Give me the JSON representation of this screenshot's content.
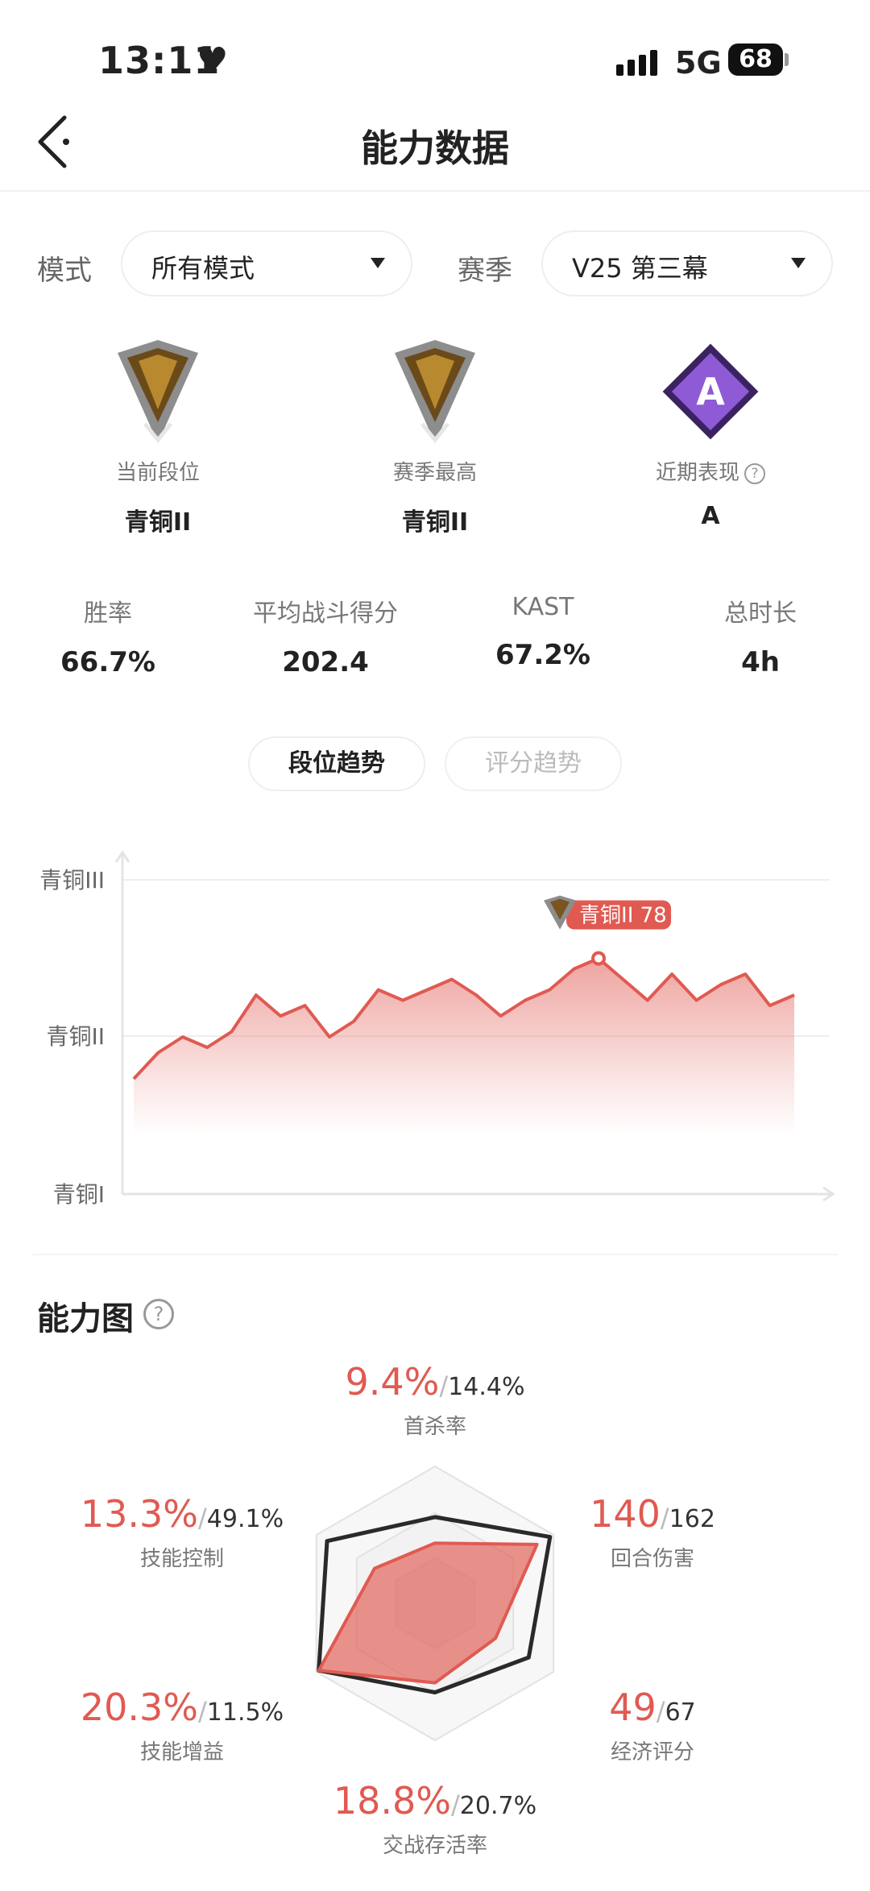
{
  "status_bar": {
    "time": "13:11",
    "network": "5G",
    "battery": "68"
  },
  "header": {
    "title": "能力数据"
  },
  "filters": {
    "mode_label": "模式",
    "mode_value": "所有模式",
    "season_label": "赛季",
    "season_value": "V25 第三幕"
  },
  "ranks": [
    {
      "label": "当前段位",
      "value": "青铜II"
    },
    {
      "label": "赛季最高",
      "value": "青铜II"
    },
    {
      "label": "近期表现",
      "value": "A",
      "badge_letter": "A"
    }
  ],
  "stats": [
    {
      "label": "胜率",
      "value": "66.7%"
    },
    {
      "label": "平均战斗得分",
      "value": "202.4"
    },
    {
      "label": "KAST",
      "value": "67.2%"
    },
    {
      "label": "总时长",
      "value": "4h"
    }
  ],
  "tabs": {
    "rank_trend": "段位趋势",
    "score_trend": "评分趋势"
  },
  "chart_data": {
    "type": "area",
    "y_tick_labels": [
      "青铜III",
      "青铜II",
      "青铜I"
    ],
    "values": [
      62,
      67,
      70,
      68,
      71,
      78,
      74,
      76,
      70,
      73,
      79,
      77,
      79,
      81,
      78,
      74,
      77,
      79,
      83,
      85,
      81,
      77,
      82,
      77,
      80,
      82,
      76,
      78
    ],
    "highlight_index": 19,
    "tooltip": "青铜II 78",
    "color": "#e05a52"
  },
  "ability": {
    "title": "能力图",
    "metrics": [
      {
        "name": "首杀率",
        "value": "9.4%",
        "compare": "14.4%"
      },
      {
        "name": "回合伤害",
        "value": "140",
        "compare": "162"
      },
      {
        "name": "经济评分",
        "value": "49",
        "compare": "67"
      },
      {
        "name": "交战存活率",
        "value": "18.8%",
        "compare": "20.7%"
      },
      {
        "name": "技能增益",
        "value": "20.3%",
        "compare": "11.5%"
      },
      {
        "name": "技能控制",
        "value": "13.3%",
        "compare": "49.1%"
      }
    ],
    "player_levels": [
      0.44,
      0.86,
      0.51,
      0.58,
      0.98,
      0.51
    ],
    "compare_levels": [
      0.63,
      0.97,
      0.79,
      0.65,
      0.98,
      0.91
    ],
    "accent_color": "#e05a52"
  }
}
